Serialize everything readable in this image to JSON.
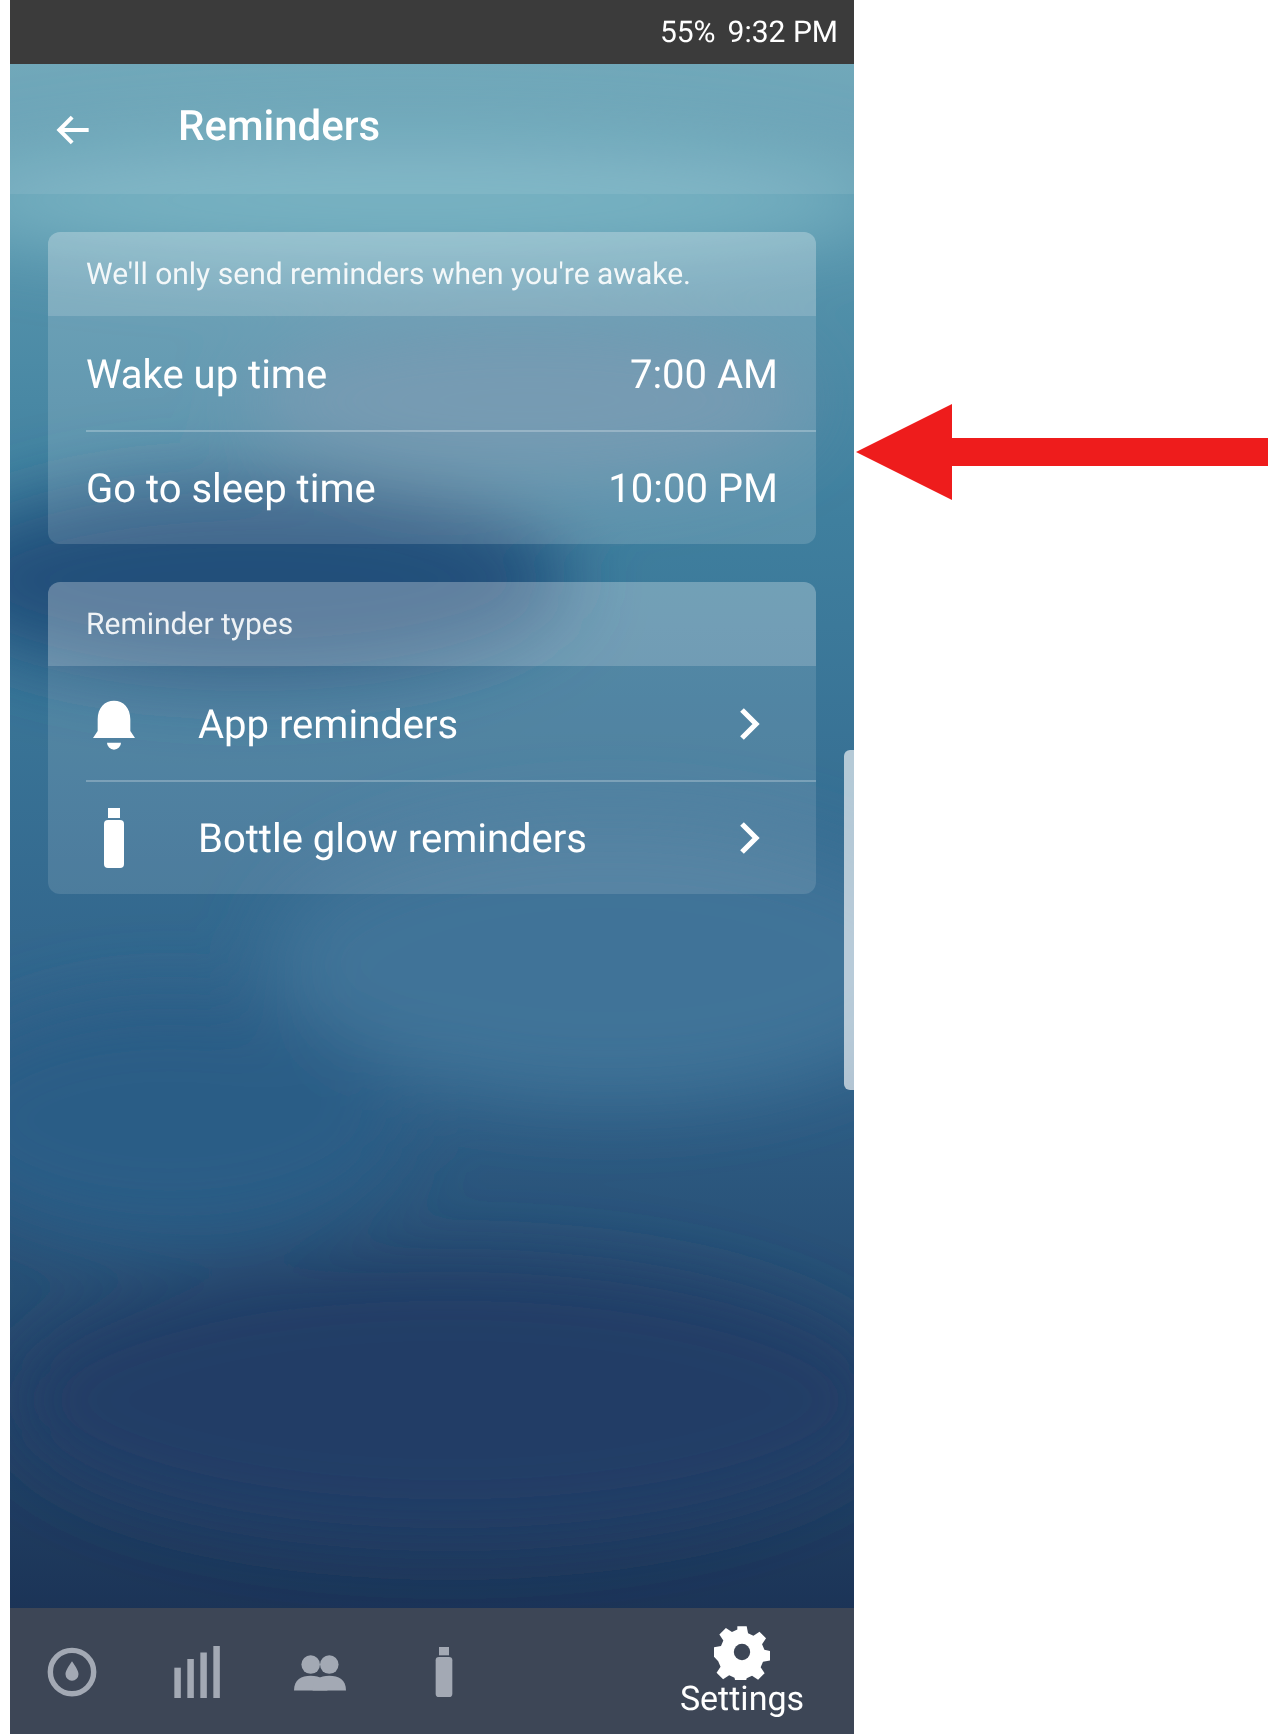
{
  "status_bar": {
    "battery": "55%",
    "time": "9:32 PM"
  },
  "header": {
    "title": "Reminders"
  },
  "schedule": {
    "note": "We'll only send reminders when you're awake.",
    "rows": [
      {
        "label": "Wake up time",
        "value": "7:00 AM"
      },
      {
        "label": "Go to sleep time",
        "value": "10:00 PM"
      }
    ]
  },
  "types": {
    "heading": "Reminder types",
    "rows": [
      {
        "kind": "bell",
        "label": "App reminders"
      },
      {
        "kind": "bottle",
        "label": "Bottle glow reminders"
      }
    ]
  },
  "nav": [
    {
      "kind": "drop",
      "selected": false
    },
    {
      "kind": "bars",
      "selected": false
    },
    {
      "kind": "people",
      "selected": false
    },
    {
      "kind": "bottle",
      "selected": false
    },
    {
      "kind": "gear",
      "label": "Settings",
      "selected": true
    }
  ]
}
